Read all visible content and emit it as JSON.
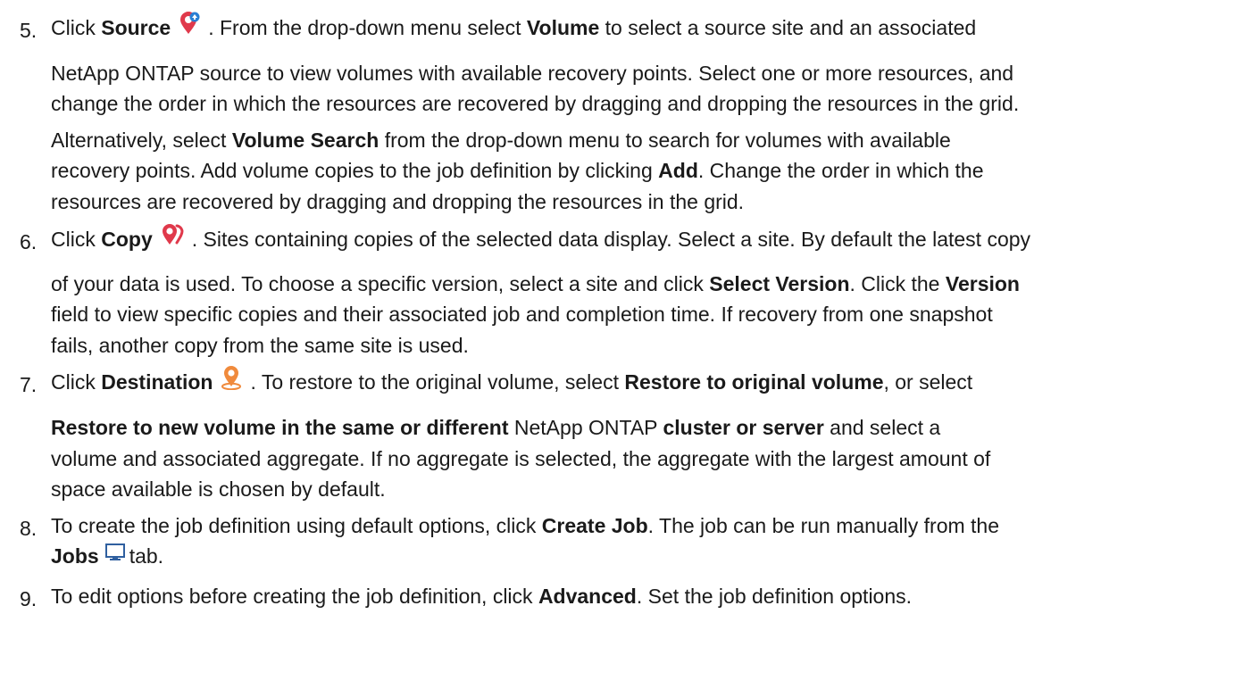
{
  "steps": [
    {
      "number": "5.",
      "lines": [
        {
          "parts": [
            {
              "t": "Click "
            },
            {
              "b": "Source"
            },
            {
              "icon": "source-pin-icon"
            },
            {
              "t": ". From the drop-down menu select "
            },
            {
              "b": "Volume"
            },
            {
              "t": " to select a source site and an associated"
            }
          ]
        },
        {
          "parts": [
            {
              "t": "NetApp ONTAP source to view volumes with available recovery points. Select one or more resources, and"
            }
          ]
        },
        {
          "parts": [
            {
              "t": "change the order in which the resources are recovered by dragging and dropping the resources in the grid."
            }
          ]
        },
        {
          "parts": [
            {
              "t": "Alternatively, select "
            },
            {
              "b": "Volume Search"
            },
            {
              "t": " from the drop-down menu to search for volumes with available"
            }
          ]
        },
        {
          "parts": [
            {
              "t": "recovery points. Add volume copies to the job definition by clicking "
            },
            {
              "b": "Add"
            },
            {
              "t": ". Change the order in which the"
            }
          ]
        },
        {
          "parts": [
            {
              "t": "resources are recovered by dragging and dropping the resources in the grid."
            }
          ]
        }
      ]
    },
    {
      "number": "6.",
      "lines": [
        {
          "parts": [
            {
              "t": "Click "
            },
            {
              "b": "Copy"
            },
            {
              "icon": "copy-pin-icon"
            },
            {
              "t": ". Sites containing copies of the selected data display. Select a site. By default the latest copy"
            }
          ]
        },
        {
          "parts": [
            {
              "t": "of your data is used. To choose a specific version, select a site and click "
            },
            {
              "b": "Select Version"
            },
            {
              "t": ". Click the "
            },
            {
              "b": "Version"
            }
          ]
        },
        {
          "parts": [
            {
              "t": "field to view specific copies and their associated job and completion time. If recovery from one snapshot"
            }
          ]
        },
        {
          "parts": [
            {
              "t": "fails, another copy from the same site is used."
            }
          ]
        }
      ]
    },
    {
      "number": "7.",
      "lines": [
        {
          "parts": [
            {
              "t": "Click "
            },
            {
              "b": "Destination"
            },
            {
              "icon": "destination-pin-icon"
            },
            {
              "t": ". To restore to the original volume, select "
            },
            {
              "b": "Restore to original volume"
            },
            {
              "t": ", or select"
            }
          ]
        },
        {
          "parts": [
            {
              "b": "Restore to new volume in the same or different"
            },
            {
              "t": " NetApp ONTAP "
            },
            {
              "b": "cluster or server"
            },
            {
              "t": " and select a"
            }
          ]
        },
        {
          "parts": [
            {
              "t": "volume and associated aggregate. If no aggregate is selected, the aggregate with the largest amount of"
            }
          ]
        },
        {
          "parts": [
            {
              "t": "space available is chosen by default."
            }
          ]
        }
      ]
    },
    {
      "number": "8.",
      "lines": [
        {
          "parts": [
            {
              "t": "To create the job definition using default options, click "
            },
            {
              "b": "Create Job"
            },
            {
              "t": ". The job can be run manually from the"
            }
          ]
        },
        {
          "parts": [
            {
              "b": "Jobs"
            },
            {
              "icon": "monitor-icon"
            },
            {
              "t": "tab."
            }
          ]
        }
      ]
    },
    {
      "number": "9.",
      "lines": [
        {
          "parts": [
            {
              "t": "To edit options before creating the job definition, click "
            },
            {
              "b": "Advanced"
            },
            {
              "t": ". Set the job definition options."
            }
          ]
        }
      ]
    }
  ],
  "icon_colors": {
    "source": "#e0394b",
    "source_badge": "#2a7fd4",
    "copy": "#e0394b",
    "destination": "#f08a3c",
    "monitor": "#2f5f9f"
  }
}
